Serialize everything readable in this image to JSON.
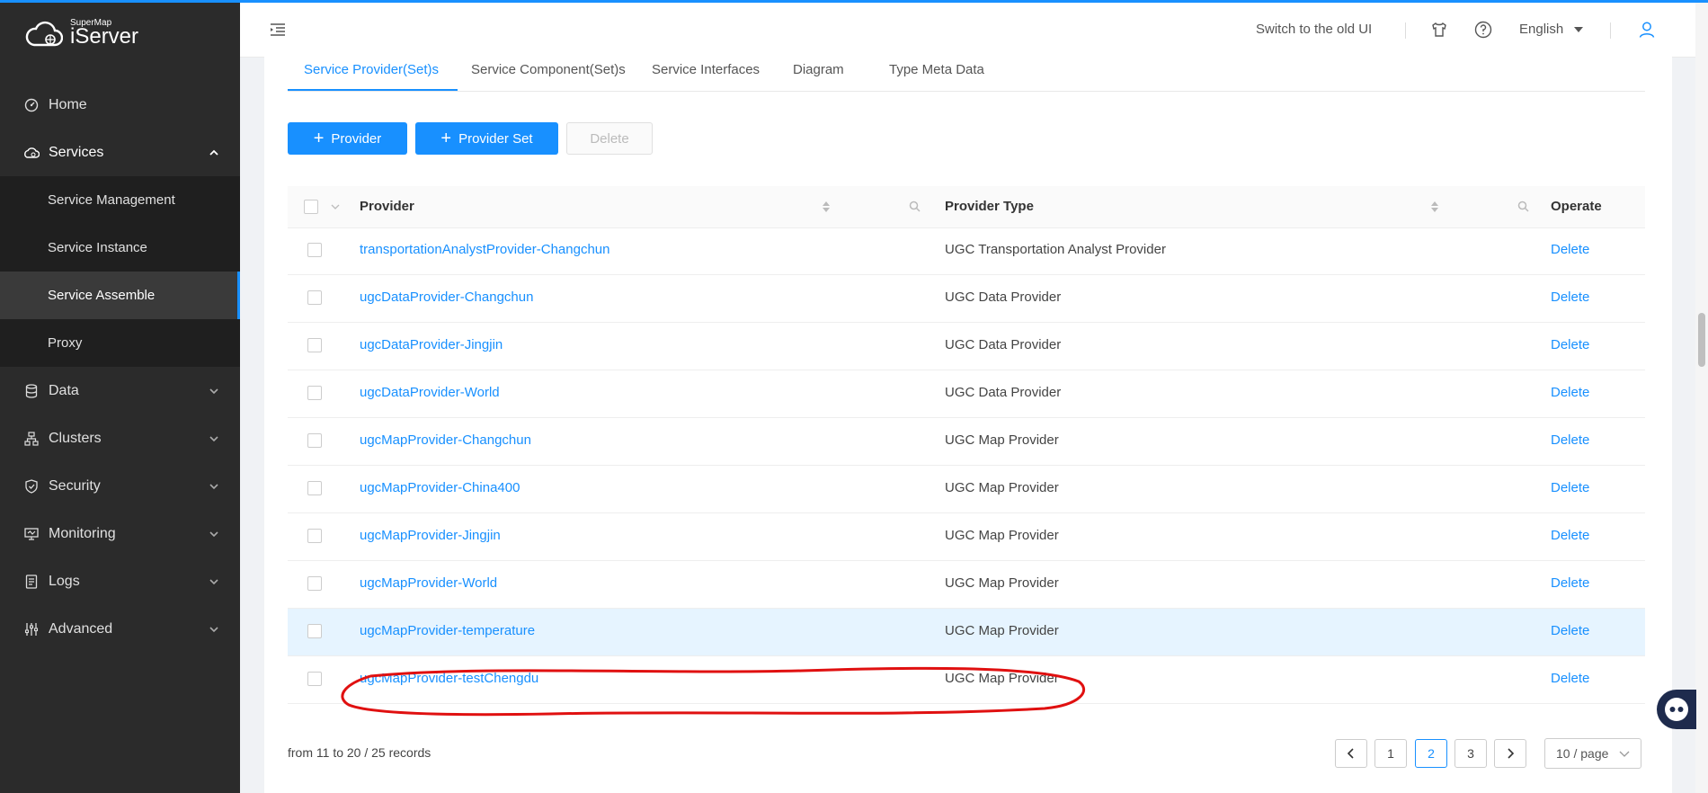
{
  "brand": {
    "small": "SuperMap",
    "name": "iServer"
  },
  "sidebar": {
    "items": [
      {
        "label": "Home",
        "icon": "dashboard-icon"
      },
      {
        "label": "Services",
        "icon": "cloud-icon",
        "expanded": true,
        "children": [
          "Service Management",
          "Service Instance",
          "Service Assemble",
          "Proxy"
        ],
        "active_child": "Service Assemble"
      },
      {
        "label": "Data",
        "icon": "database-icon"
      },
      {
        "label": "Clusters",
        "icon": "cluster-icon"
      },
      {
        "label": "Security",
        "icon": "shield-icon"
      },
      {
        "label": "Monitoring",
        "icon": "monitor-icon"
      },
      {
        "label": "Logs",
        "icon": "log-icon"
      },
      {
        "label": "Advanced",
        "icon": "sliders-icon"
      }
    ]
  },
  "header": {
    "old_ui_link": "Switch to the old UI",
    "language": "English",
    "icons": [
      "skin-icon",
      "help-icon",
      "user-icon"
    ]
  },
  "tabs": {
    "items": [
      "Service Provider(Set)s",
      "Service Component(Set)s",
      "Service Interfaces",
      "Diagram",
      "Type Meta Data"
    ],
    "active": "Service Provider(Set)s"
  },
  "toolbar": {
    "add_provider": "Provider",
    "add_provider_set": "Provider Set",
    "delete": "Delete"
  },
  "table": {
    "columns": {
      "provider": "Provider",
      "provider_type": "Provider Type",
      "operate": "Operate"
    },
    "rows": [
      {
        "provider": "transportationAnalystProvider-Changchun",
        "type": "UGC Transportation Analyst Provider",
        "op": "Delete"
      },
      {
        "provider": "ugcDataProvider-Changchun",
        "type": "UGC Data Provider",
        "op": "Delete"
      },
      {
        "provider": "ugcDataProvider-Jingjin",
        "type": "UGC Data Provider",
        "op": "Delete"
      },
      {
        "provider": "ugcDataProvider-World",
        "type": "UGC Data Provider",
        "op": "Delete"
      },
      {
        "provider": "ugcMapProvider-Changchun",
        "type": "UGC Map Provider",
        "op": "Delete"
      },
      {
        "provider": "ugcMapProvider-China400",
        "type": "UGC Map Provider",
        "op": "Delete"
      },
      {
        "provider": "ugcMapProvider-Jingjin",
        "type": "UGC Map Provider",
        "op": "Delete"
      },
      {
        "provider": "ugcMapProvider-World",
        "type": "UGC Map Provider",
        "op": "Delete"
      },
      {
        "provider": "ugcMapProvider-temperature",
        "type": "UGC Map Provider",
        "op": "Delete"
      },
      {
        "provider": "ugcMapProvider-testChengdu",
        "type": "UGC Map Provider",
        "op": "Delete"
      }
    ],
    "hovered_row": 9,
    "highlighted_row": 10
  },
  "pagination": {
    "summary": "from 11 to 20 / 25 records",
    "pages": [
      "1",
      "2",
      "3"
    ],
    "current": "2",
    "page_size": "10 / page"
  },
  "colors": {
    "accent": "#1890ff",
    "sidebar": "#2b2b2b",
    "annotation": "#e01010",
    "hover_row": "#e6f4ff"
  }
}
